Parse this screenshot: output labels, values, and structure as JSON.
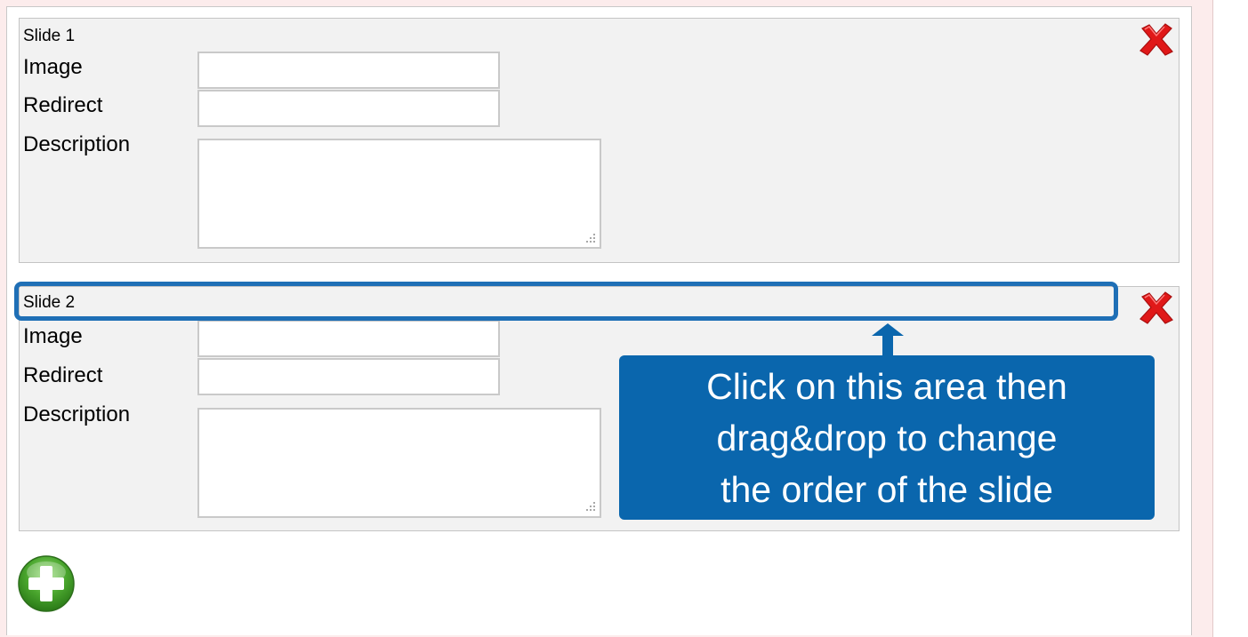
{
  "slides": [
    {
      "title": "Slide 1",
      "image_label": "Image",
      "image_value": "",
      "redirect_label": "Redirect",
      "redirect_value": "",
      "description_label": "Description",
      "description_value": ""
    },
    {
      "title": "Slide 2",
      "image_label": "Image",
      "image_value": "",
      "redirect_label": "Redirect",
      "redirect_value": "",
      "description_label": "Description",
      "description_value": ""
    }
  ],
  "callout": {
    "line1": "Click on this area then",
    "line2": "drag&drop to change",
    "line3": "the order of the slide"
  },
  "icons": {
    "delete": "close-icon",
    "add": "plus-icon",
    "arrow": "arrow-up-icon"
  },
  "colors": {
    "delete_red": "#e01818",
    "add_green": "#4aa62e",
    "highlight_blue": "#1f6fb6",
    "callout_blue": "#0a66ad"
  }
}
